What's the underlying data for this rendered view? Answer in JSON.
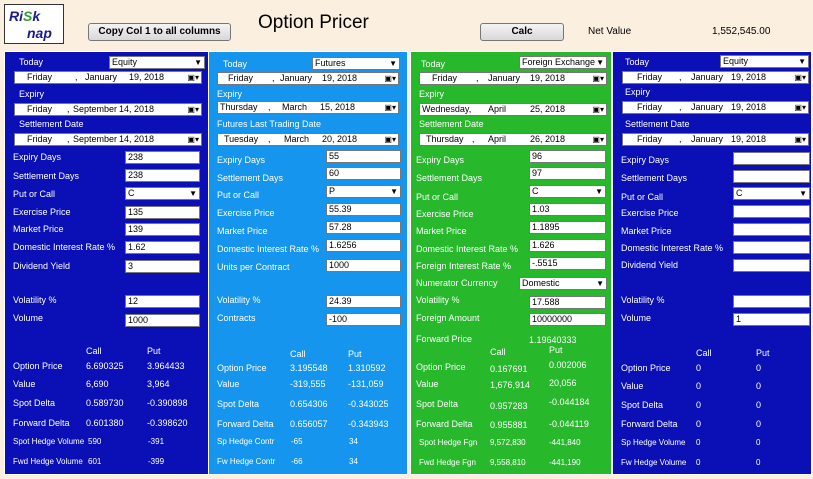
{
  "app": {
    "logo_line1a": "Ri",
    "logo_line1b": "S",
    "logo_line1c": "k",
    "logo_line2": "nap",
    "title": "Option Pricer",
    "copy_btn": "Copy Col 1 to all columns",
    "calc_btn": "Calc",
    "net_value_label": "Net Value",
    "net_value": "1,552,545.00"
  },
  "labels": {
    "today": "Today",
    "expiry": "Expiry",
    "settlement_date": "Settlement Date",
    "futures_last": "Futures Last Trading Date",
    "expiry_days": "Expiry Days",
    "settlement_days": "Settlement Days",
    "put_or_call": "Put or Call",
    "exercise_price": "Exercise Price",
    "market_price": "Market Price",
    "dom_rate": "Domestic Interest Rate %",
    "dividend_yield": "Dividend Yield",
    "units_per_contract": "Units per Contract",
    "foreign_rate": "Foreign Interest Rate %",
    "numerator_currency": "Numerator Currency",
    "volatility": "Volatility %",
    "volume": "Volume",
    "contracts": "Contracts",
    "foreign_amount": "Foreign Amount",
    "forward_price": "Forward Price",
    "call": "Call",
    "put": "Put",
    "option_price": "Option Price",
    "value": "Value",
    "spot_delta": "Spot Delta",
    "forward_delta": "Forward Delta",
    "spot_hedge_volume": "Spot Hedge Volume",
    "fwd_hedge_volume": "Fwd Hedge Volume",
    "sp_hedge_contr": "Sp Hedge Contr",
    "fw_hedge_contr": "Fw Hedge Contr",
    "spot_hedge_fgn": "Spot Hedge Fgn",
    "fwd_hedge_fgn": "Fwd Hedge Fgn"
  },
  "col1": {
    "type": "Equity",
    "today": {
      "dow": "Friday",
      "month": "January",
      "day": "19, 2018"
    },
    "expiry": {
      "dow": "Friday",
      "month": "September",
      "day": "14, 2018"
    },
    "settle": {
      "dow": "Friday",
      "month": "September",
      "day": "14, 2018"
    },
    "expiry_days": "238",
    "settlement_days": "238",
    "put_or_call": "C",
    "exercise_price": "135",
    "market_price": "139",
    "dom_rate": "1.62",
    "dividend_yield": "3",
    "volatility": "12",
    "volume": "1000",
    "option_price_call": "6.690325",
    "option_price_put": "3.964433",
    "value_call": "6,690",
    "value_put": "3,964",
    "spot_delta_call": "0.589730",
    "spot_delta_put": "-0.390898",
    "fwd_delta_call": "0.601380",
    "fwd_delta_put": "-0.398620",
    "spot_hedge_call": "590",
    "spot_hedge_put": "-391",
    "fwd_hedge_call": "601",
    "fwd_hedge_put": "-399"
  },
  "col2": {
    "type": "Futures",
    "today": {
      "dow": "Friday",
      "month": "January",
      "day": "19, 2018"
    },
    "expiry": {
      "dow": "Thursday",
      "month": "March",
      "day": "15, 2018"
    },
    "futures_last": {
      "dow": "Tuesday",
      "month": "March",
      "day": "20, 2018"
    },
    "expiry_days": "55",
    "settlement_days": "60",
    "put_or_call": "P",
    "exercise_price": "55.39",
    "market_price": "57.28",
    "dom_rate": "1.6256",
    "units_per_contract": "1000",
    "volatility": "24.39",
    "contracts": "-100",
    "option_price_call": "3.195548",
    "option_price_put": "1.310592",
    "value_call": "-319,555",
    "value_put": "-131,059",
    "spot_delta_call": "0.654306",
    "spot_delta_put": "-0.343025",
    "fwd_delta_call": "0.656057",
    "fwd_delta_put": "-0.343943",
    "sp_hedge_call": "-65",
    "sp_hedge_put": "34",
    "fw_hedge_call": "-66",
    "fw_hedge_put": "34"
  },
  "col3": {
    "type": "Foreign Exchange",
    "today": {
      "dow": "Friday",
      "month": "January",
      "day": "19, 2018"
    },
    "expiry": {
      "dow": "Wednesday,",
      "month": "April",
      "day": "25, 2018"
    },
    "settle": {
      "dow": "Thursday",
      "month": "April",
      "day": "26, 2018"
    },
    "expiry_days": "96",
    "settlement_days": "97",
    "put_or_call": "C",
    "exercise_price": "1.03",
    "market_price": "1.1895",
    "dom_rate": "1.626",
    "foreign_rate": "-.5515",
    "numerator_currency": "Domestic",
    "volatility": "17.588",
    "foreign_amount": "10000000",
    "forward_price": "1.19640333",
    "option_price_call": "0.167691",
    "option_price_put": "0.002006",
    "value_call": "1,676,914",
    "value_put": "20,056",
    "spot_delta_call": "0.957283",
    "spot_delta_put": "-0.044184",
    "fwd_delta_call": "0.955881",
    "fwd_delta_put": "-0.044119",
    "spot_hedge_call": "9,572,830",
    "spot_hedge_put": "-441,840",
    "fwd_hedge_call": "9,558,810",
    "fwd_hedge_put": "-441,190"
  },
  "col4": {
    "type": "Equity",
    "today": {
      "dow": "Friday",
      "month": "January",
      "day": "19, 2018"
    },
    "expiry": {
      "dow": "Friday",
      "month": "January",
      "day": "19, 2018"
    },
    "settle": {
      "dow": "Friday",
      "month": "January",
      "day": "19, 2018"
    },
    "put_or_call": "C",
    "volume": "1",
    "option_price_call": "0",
    "option_price_put": "0",
    "value_call": "0",
    "value_put": "0",
    "spot_delta_call": "0",
    "spot_delta_put": "0",
    "fwd_delta_call": "0",
    "fwd_delta_put": "0",
    "sp_hedge_call": "0",
    "sp_hedge_put": "0",
    "fw_hedge_call": "0",
    "fw_hedge_put": "0"
  }
}
